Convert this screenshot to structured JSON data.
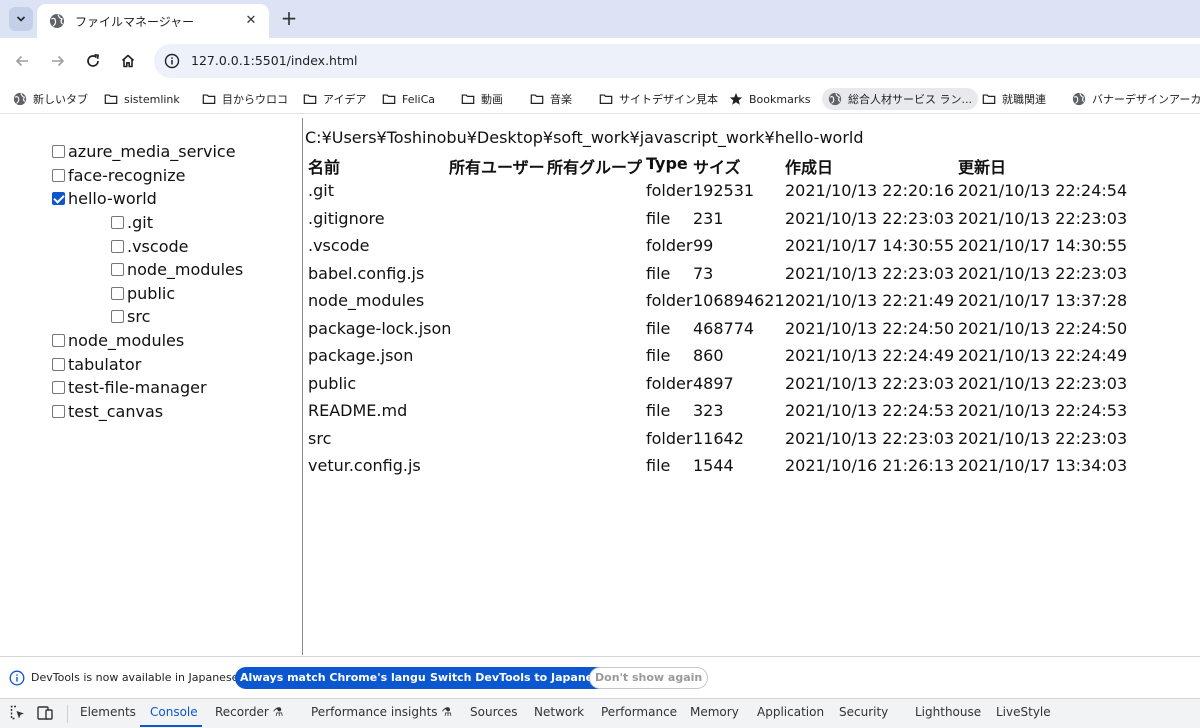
{
  "browser": {
    "tab_title": "ファイルマネージャー",
    "url": "127.0.0.1:5501/index.html"
  },
  "bookmarks": [
    {
      "label": "新しいタブ",
      "icon": "globe-icon"
    },
    {
      "label": "sistemlink",
      "icon": "folder-icon"
    },
    {
      "label": "目からウロコ",
      "icon": "folder-icon"
    },
    {
      "label": "アイデア",
      "icon": "folder-icon"
    },
    {
      "label": "FeliCa",
      "icon": "folder-icon"
    },
    {
      "label": "動画",
      "icon": "folder-icon"
    },
    {
      "label": "音楽",
      "icon": "folder-icon"
    },
    {
      "label": "サイトデザイン見本",
      "icon": "folder-icon"
    },
    {
      "label": "Bookmarks",
      "icon": "star-icon"
    },
    {
      "label": "総合人材サービス ラン...",
      "icon": "globe-icon"
    },
    {
      "label": "就職関連",
      "icon": "folder-icon"
    },
    {
      "label": "バナーデザインアーカイブ...",
      "icon": "globe-icon"
    }
  ],
  "tree": [
    {
      "label": "azure_media_service",
      "checked": false,
      "level": 0
    },
    {
      "label": "face-recognize",
      "checked": false,
      "level": 0
    },
    {
      "label": "hello-world",
      "checked": true,
      "level": 0
    },
    {
      "label": ".git",
      "checked": false,
      "level": 1
    },
    {
      "label": ".vscode",
      "checked": false,
      "level": 1
    },
    {
      "label": "node_modules",
      "checked": false,
      "level": 1
    },
    {
      "label": "public",
      "checked": false,
      "level": 1
    },
    {
      "label": "src",
      "checked": false,
      "level": 1
    },
    {
      "label": "node_modules",
      "checked": false,
      "level": 0
    },
    {
      "label": "tabulator",
      "checked": false,
      "level": 0
    },
    {
      "label": "test-file-manager",
      "checked": false,
      "level": 0
    },
    {
      "label": "test_canvas",
      "checked": false,
      "level": 0
    }
  ],
  "listing": {
    "path": "C:¥Users¥Toshinobu¥Desktop¥soft_work¥javascript_work¥hello-world",
    "headers": [
      "名前",
      "所有ユーザー",
      "所有グループ",
      "Type",
      "サイズ",
      "作成日",
      "更新日"
    ],
    "rows": [
      {
        "name": ".git",
        "type": "folder",
        "size": "192531",
        "created": "2021/10/13 22:20:16",
        "updated": "2021/10/13 22:24:54"
      },
      {
        "name": ".gitignore",
        "type": "file",
        "size": "231",
        "created": "2021/10/13 22:23:03",
        "updated": "2021/10/13 22:23:03"
      },
      {
        "name": ".vscode",
        "type": "folder",
        "size": "99",
        "created": "2021/10/17 14:30:55",
        "updated": "2021/10/17 14:30:55"
      },
      {
        "name": "babel.config.js",
        "type": "file",
        "size": "73",
        "created": "2021/10/13 22:23:03",
        "updated": "2021/10/13 22:23:03"
      },
      {
        "name": "node_modules",
        "type": "folder",
        "size": "106894621",
        "created": "2021/10/13 22:21:49",
        "updated": "2021/10/17 13:37:28"
      },
      {
        "name": "package-lock.json",
        "type": "file",
        "size": "468774",
        "created": "2021/10/13 22:24:50",
        "updated": "2021/10/13 22:24:50"
      },
      {
        "name": "package.json",
        "type": "file",
        "size": "860",
        "created": "2021/10/13 22:24:49",
        "updated": "2021/10/13 22:24:49"
      },
      {
        "name": "public",
        "type": "folder",
        "size": "4897",
        "created": "2021/10/13 22:23:03",
        "updated": "2021/10/13 22:23:03"
      },
      {
        "name": "README.md",
        "type": "file",
        "size": "323",
        "created": "2021/10/13 22:24:53",
        "updated": "2021/10/13 22:24:53"
      },
      {
        "name": "src",
        "type": "folder",
        "size": "11642",
        "created": "2021/10/13 22:23:03",
        "updated": "2021/10/13 22:23:03"
      },
      {
        "name": "vetur.config.js",
        "type": "file",
        "size": "1544",
        "created": "2021/10/16 21:26:13",
        "updated": "2021/10/17 13:34:03"
      }
    ]
  },
  "devtools": {
    "info_text": "DevTools is now available in Japanese!",
    "btn_match": "Always match Chrome's language",
    "btn_switch": "Switch DevTools to Japanese",
    "btn_dismiss": "Don't show again",
    "tabs": [
      "Elements",
      "Console",
      "Recorder",
      "Performance insights",
      "Sources",
      "Network",
      "Performance",
      "Memory",
      "Application",
      "Security",
      "Lighthouse",
      "LiveStyle"
    ],
    "selected_tab": "Console",
    "accent": "#0b57d0"
  }
}
